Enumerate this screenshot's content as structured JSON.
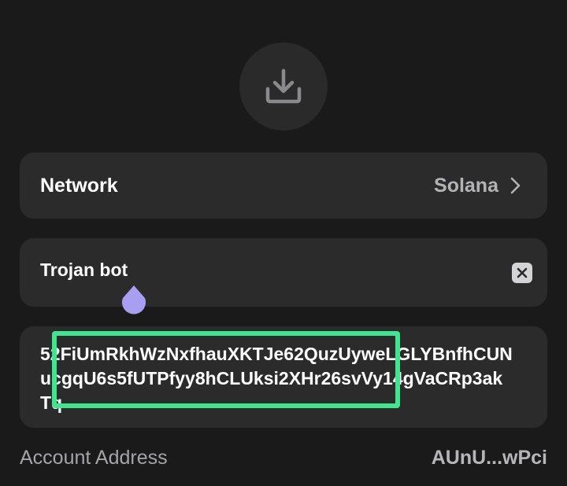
{
  "header": {
    "download_icon": "download-icon"
  },
  "network": {
    "label": "Network",
    "value": "Solana",
    "chevron_icon": "chevron-right-icon"
  },
  "wallet_name": {
    "value": "Trojan bot",
    "clear_icon": "clear-icon"
  },
  "private_key": {
    "text": "52FiUmRkhWzNxfhauXKTJe62QuzUyweLGLYBnfhCUNucgqU6s5fUTPfyy8hCLUksi2XHr26svVy14gVaCRp3akTq"
  },
  "account": {
    "label": "Account Address",
    "value": "AUnU...wPci"
  },
  "colors": {
    "background": "#1a1a1b",
    "card": "#2b2b2c",
    "highlight": "#3ee68f",
    "cursor_handle": "#a99ff0"
  }
}
